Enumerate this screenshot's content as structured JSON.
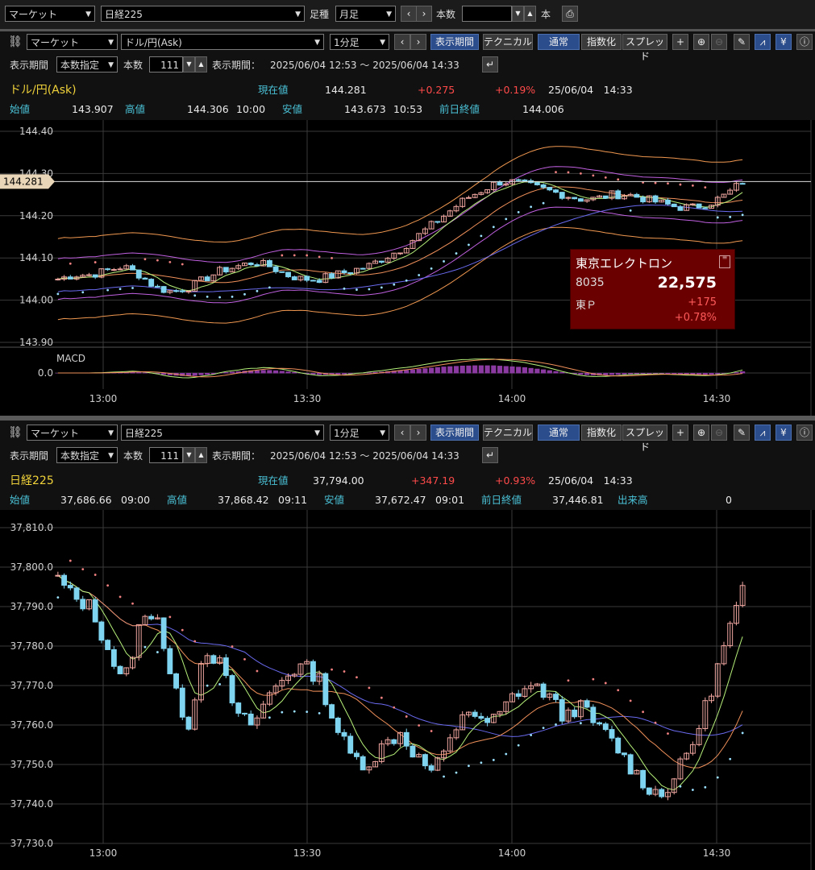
{
  "toolbar": {
    "market_select": "マーケット",
    "index_select": "日経225",
    "ashi_label": "足種",
    "ashi_select": "月足",
    "count_label": "本数",
    "count_value": "",
    "count_unit": "本"
  },
  "panel1": {
    "market_select": "マーケット",
    "symbol_select": "ドル/円(Ask)",
    "interval_select": "1分足",
    "buttons": {
      "period": "表示期間",
      "technical": "テクニカル",
      "normal": "通常",
      "index": "指数化",
      "spread": "スプレッド"
    },
    "period_label": "表示期間",
    "period_mode": "本数指定",
    "count_label": "本数",
    "count_value": "111",
    "range_label": "表示期間：",
    "range_value": "2025/06/04 12:53 ～ 2025/06/04 14:33",
    "name": "ドル/円(Ask)",
    "current_label": "現在値",
    "current_value": "144.281",
    "change": "+0.275",
    "change_pct": "+0.19%",
    "datetime": "25/06/04　14:33",
    "open_label": "始値",
    "open_value": "143.907",
    "high_label": "高値",
    "high_value": "144.306",
    "high_time": "10:00",
    "low_label": "安値",
    "low_value": "143.673",
    "low_time": "10:53",
    "prev_label": "前日終値",
    "prev_value": "144.006",
    "price_tag": "144.281",
    "macd_label": "MACD"
  },
  "panel2": {
    "market_select": "マーケット",
    "symbol_select": "日経225",
    "interval_select": "1分足",
    "buttons": {
      "period": "表示期間",
      "technical": "テクニカル",
      "normal": "通常",
      "index": "指数化",
      "spread": "スプレッド"
    },
    "period_label": "表示期間",
    "period_mode": "本数指定",
    "count_label": "本数",
    "count_value": "111",
    "range_label": "表示期間：",
    "range_value": "2025/06/04 12:53 ～ 2025/06/04 14:33",
    "name": "日経225",
    "current_label": "現在値",
    "current_value": "37,794.00",
    "change": "+347.19",
    "change_pct": "+0.93%",
    "datetime": "25/06/04　14:33",
    "open_label": "始値",
    "open_value": "37,686.66",
    "open_time": "09:00",
    "high_label": "高値",
    "high_value": "37,868.42",
    "high_time": "09:11",
    "low_label": "安値",
    "low_value": "37,672.47",
    "low_time": "09:01",
    "prev_label": "前日終値",
    "prev_value": "37,446.81",
    "volume_label": "出来高",
    "volume_value": "0"
  },
  "popup": {
    "name": "東京エレクトロン",
    "code": "8035",
    "price": "22,575",
    "market": "東Ｐ",
    "change": "+175",
    "change_pct": "+0.78%"
  },
  "colors": {
    "up": "#f0a6a0",
    "down": "#7fd4f0",
    "ma_short": "#b6f07a",
    "ma_mid": "#f0905a",
    "ma_long": "#6a6af0",
    "sar_up": "#f08080",
    "sar_down": "#9ae0ff",
    "bb": "#f09850",
    "bb2": "#c060e0"
  },
  "chart_data": [
    {
      "type": "line",
      "title": "ドル/円(Ask)",
      "x_ticks": [
        "13:00",
        "13:30",
        "14:00",
        "14:30"
      ],
      "y_ticks": [
        "143.90",
        "144.00",
        "144.10",
        "144.20",
        "144.30",
        "144.40"
      ],
      "ylim": [
        143.9,
        144.4
      ],
      "series": [
        {
          "name": "ドル/円(Ask)",
          "values": [
            144.05,
            144.06,
            144.06,
            144.07,
            144.08,
            144.06,
            144.03,
            144.02,
            144.03,
            144.05,
            144.07,
            144.08,
            144.09,
            144.08,
            144.06,
            144.05,
            144.05,
            144.06,
            144.07,
            144.08,
            144.1,
            144.12,
            144.15,
            144.18,
            144.21,
            144.24,
            144.26,
            144.28,
            144.28,
            144.27,
            144.26,
            144.25,
            144.24,
            144.24,
            144.25,
            144.25,
            144.24,
            144.23,
            144.22,
            144.22,
            144.23,
            144.25,
            144.281
          ]
        }
      ]
    },
    {
      "type": "line",
      "title": "日経225",
      "x_ticks": [
        "13:00",
        "13:30",
        "14:00",
        "14:30"
      ],
      "y_ticks": [
        "37,730.0",
        "37,740.0",
        "37,750.0",
        "37,760.0",
        "37,770.0",
        "37,780.0",
        "37,790.0",
        "37,800.0",
        "37,810.0"
      ],
      "ylim": [
        37730,
        37810
      ],
      "series": [
        {
          "name": "日経225",
          "values": [
            37797,
            37792,
            37790,
            37780,
            37770,
            37785,
            37790,
            37770,
            37760,
            37780,
            37775,
            37762,
            37760,
            37768,
            37773,
            37775,
            37772,
            37760,
            37752,
            37750,
            37755,
            37758,
            37752,
            37748,
            37755,
            37765,
            37760,
            37762,
            37768,
            37770,
            37768,
            37762,
            37765,
            37760,
            37756,
            37750,
            37745,
            37742,
            37748,
            37756,
            37768,
            37782,
            37794
          ]
        }
      ]
    }
  ]
}
